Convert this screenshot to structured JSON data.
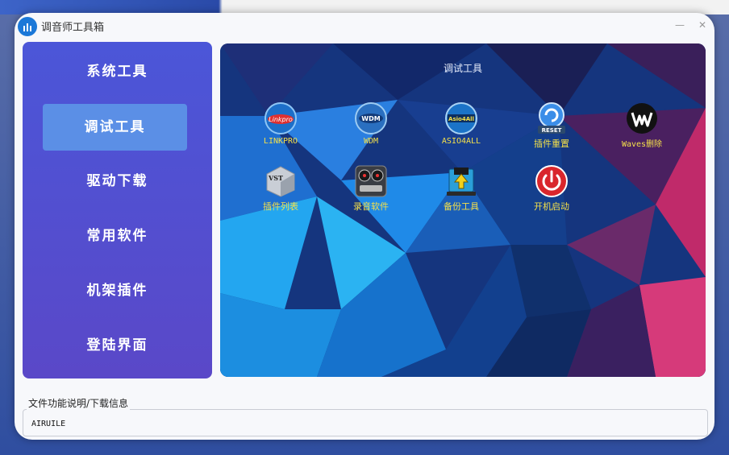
{
  "window": {
    "title": "调音师工具箱",
    "minimize_glyph": "—",
    "close_glyph": "✕"
  },
  "sidebar": {
    "items": [
      {
        "label": "系统工具",
        "active": false
      },
      {
        "label": "调试工具",
        "active": true
      },
      {
        "label": "驱动下载",
        "active": false
      },
      {
        "label": "常用软件",
        "active": false
      },
      {
        "label": "机架插件",
        "active": false
      },
      {
        "label": "登陆界面",
        "active": false
      }
    ]
  },
  "main": {
    "title": "调试工具",
    "tools": [
      {
        "label": "LINKPRO",
        "icon": "linkpro-icon",
        "icon_text": "Linkpro"
      },
      {
        "label": "WDM",
        "icon": "wdm-icon",
        "icon_text": "WDM"
      },
      {
        "label": "ASIO4ALL",
        "icon": "asio4all-icon",
        "icon_text": "Asio4All"
      },
      {
        "label": "插件重置",
        "icon": "reset-icon",
        "icon_text": "RESET"
      },
      {
        "label": "Waves删除",
        "icon": "waves-icon",
        "icon_text": ""
      },
      {
        "label": "插件列表",
        "icon": "vst-icon",
        "icon_text": "VST"
      },
      {
        "label": "录音软件",
        "icon": "tape-recorder-icon",
        "icon_text": ""
      },
      {
        "label": "备份工具",
        "icon": "backup-icon",
        "icon_text": ""
      },
      {
        "label": "开机启动",
        "icon": "power-icon",
        "icon_text": ""
      }
    ]
  },
  "footer": {
    "legend": "文件功能说明/下载信息",
    "info": "AIRUILE"
  },
  "colors": {
    "accent": "#5b8fe6",
    "sidebar_top": "#4b56d8",
    "sidebar_bottom": "#5a48c8",
    "tool_label": "#f4e04a"
  }
}
